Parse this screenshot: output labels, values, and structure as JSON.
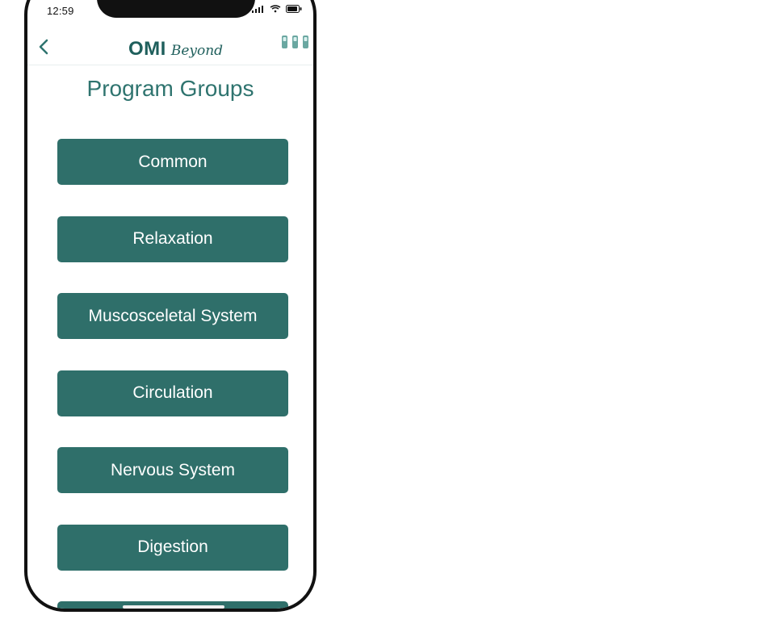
{
  "status_bar": {
    "time": "12:59",
    "icons": [
      "signal-icon",
      "wifi-icon",
      "battery-icon"
    ]
  },
  "header": {
    "back_icon": "chevron-left-icon",
    "logo_main": "OMI",
    "logo_sub": "Beyond",
    "accent_color": "#2f6f6a"
  },
  "page": {
    "title": "Program Groups"
  },
  "groups": [
    {
      "label": "Common"
    },
    {
      "label": "Relaxation"
    },
    {
      "label": "Muscosceletal System"
    },
    {
      "label": "Circulation"
    },
    {
      "label": "Nervous System"
    },
    {
      "label": "Digestion"
    }
  ]
}
